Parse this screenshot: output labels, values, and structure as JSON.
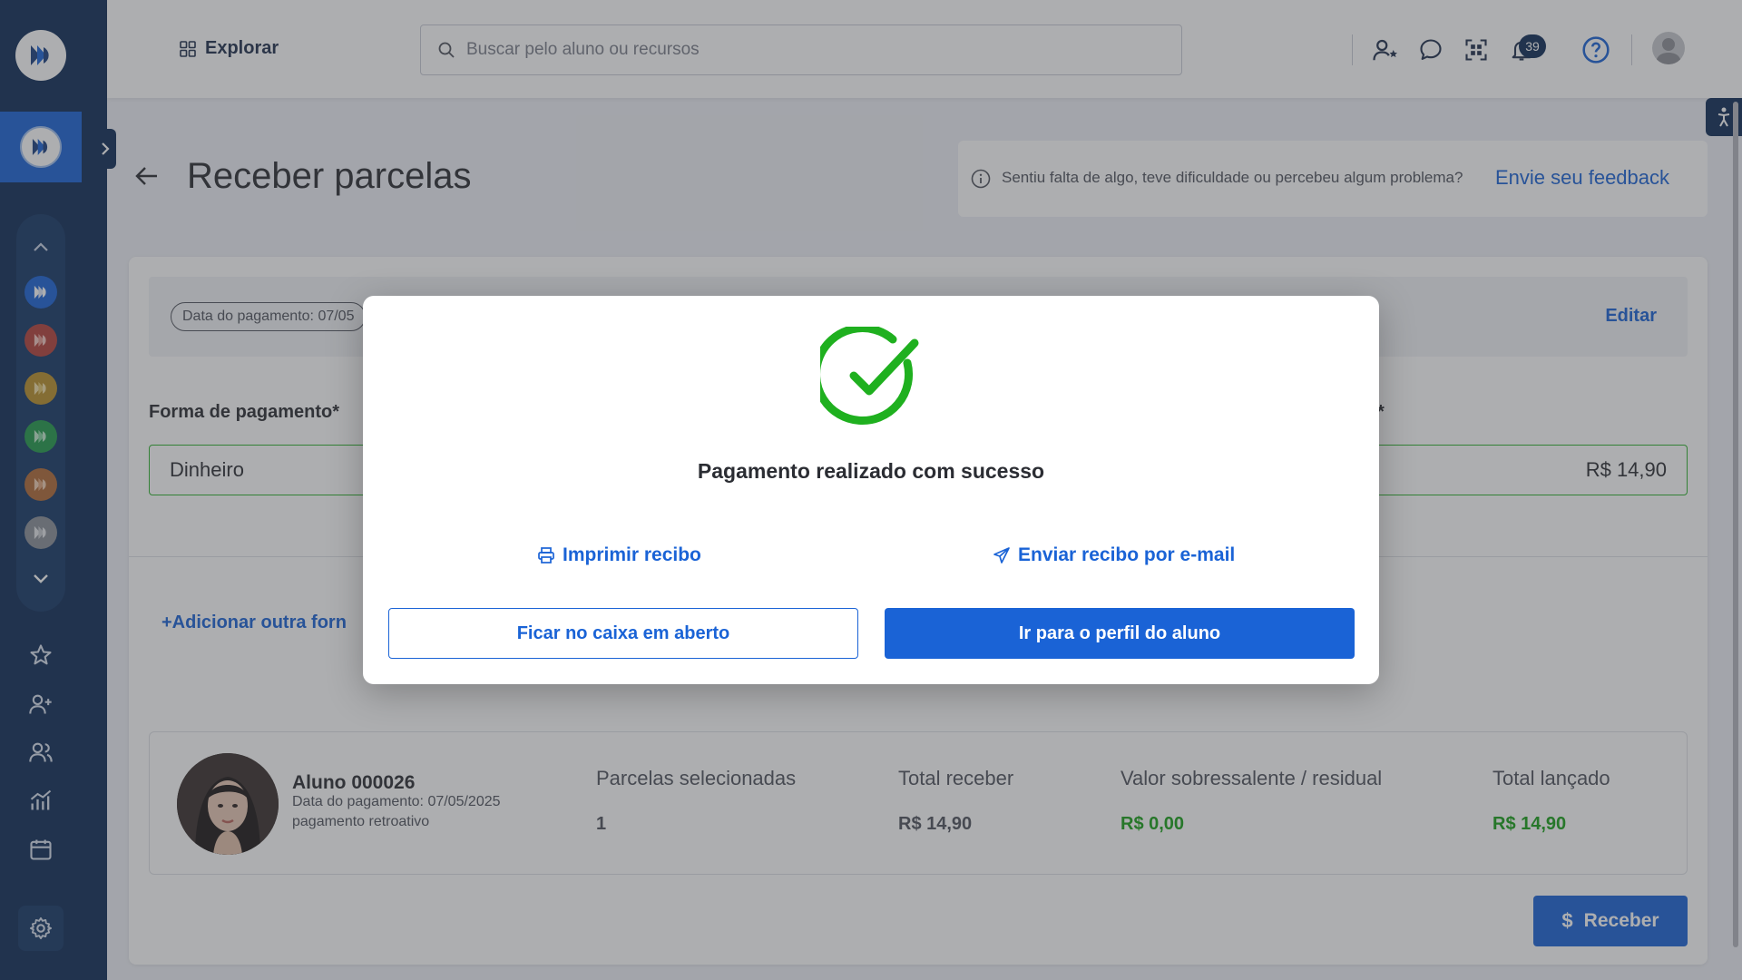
{
  "header": {
    "explore_label": "Explorar",
    "search_placeholder": "Buscar pelo aluno ou recursos",
    "notifications_count": "39"
  },
  "page": {
    "title": "Receber parcelas",
    "feedback_text": "Sentiu falta de algo, teve dificuldade ou percebeu algum problema?",
    "feedback_link": "Envie seu feedback"
  },
  "payment": {
    "date_chip": "Data do pagamento: 07/05",
    "edit_label": "Editar",
    "method_label": "Forma de pagamento*",
    "value_label_fragment": "*",
    "method_value": "Dinheiro",
    "amount_value": "R$ 14,90",
    "add_method_label": "+Adicionar outra forn"
  },
  "summary": {
    "student_name": "Aluno 000026",
    "payment_date_line": "Data do pagamento: 07/05/2025",
    "note_line": "pagamento retroativo",
    "columns": [
      {
        "head": "Parcelas selecionadas",
        "value": "1"
      },
      {
        "head": "Total receber",
        "value": "R$ 14,90"
      },
      {
        "head": "Valor sobressalente / residual",
        "value": "R$ 0,00"
      },
      {
        "head": "Total lançado",
        "value": "R$ 14,90"
      }
    ],
    "receive_button": "Receber"
  },
  "modal": {
    "message": "Pagamento realizado com sucesso",
    "print_link": "Imprimir recibo",
    "email_link": "Enviar recibo por e-mail",
    "stay_button": "Ficar no caixa em aberto",
    "profile_button": "Ir para o perfil do aluno"
  },
  "colors": {
    "brand": "#0f2c57",
    "accent": "#1a63d6",
    "success": "#19a019",
    "unit_colors": [
      "#1a63d6",
      "#b3413a",
      "#b8902a",
      "#229a4a",
      "#b06a36",
      "#8a8f98"
    ]
  },
  "icons": [
    "grid-icon",
    "search-icon",
    "user-star-icon",
    "chat-icon",
    "qr-icon",
    "bell-icon",
    "help-icon",
    "info-icon",
    "star-icon",
    "user-plus-icon",
    "users-icon",
    "chart-icon",
    "calendar-icon",
    "gear-icon",
    "printer-icon",
    "send-icon",
    "check-circle-icon",
    "dollar-icon"
  ]
}
